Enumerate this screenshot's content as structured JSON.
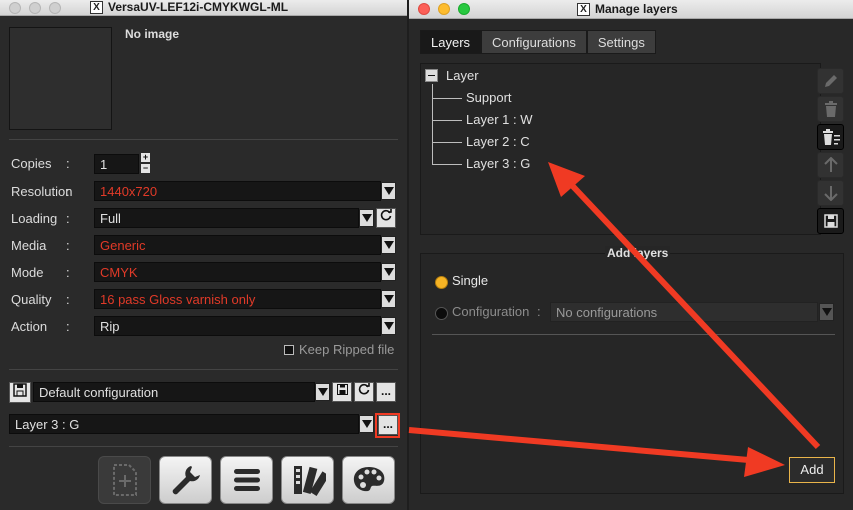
{
  "left_window": {
    "title": "VersaUV-LEF12i-CMYKWGL-ML",
    "no_image": "No image",
    "copies": {
      "label": "Copies",
      "colon": ":",
      "value": "1"
    },
    "resolution": {
      "label": "Resolution",
      "colon": ":",
      "value": "1440x720"
    },
    "loading": {
      "label": "Loading",
      "colon": ":",
      "value": "Full"
    },
    "media": {
      "label": "Media",
      "colon": ":",
      "value": "Generic"
    },
    "mode": {
      "label": "Mode",
      "colon": ":",
      "value": "CMYK"
    },
    "quality": {
      "label": "Quality",
      "colon": ":",
      "value": "16 pass Gloss varnish only"
    },
    "action": {
      "label": "Action",
      "colon": ":",
      "value": "Rip"
    },
    "keep_ripped": "Keep Ripped file",
    "configuration": "Default configuration",
    "layer_select": "Layer 3 : G",
    "more_label": "...",
    "icons": [
      "add-file-icon",
      "wrench-icon",
      "menu-icon",
      "swatch-icon",
      "palette-icon"
    ]
  },
  "right_window": {
    "title": "Manage layers",
    "tabs": [
      "Layers",
      "Configurations",
      "Settings"
    ],
    "active_tab": "Layers",
    "tree": {
      "root": "Layer",
      "children": [
        "Support",
        "Layer 1 : W",
        "Layer 2 : C",
        "Layer 3 : G"
      ]
    },
    "add_layers": {
      "title": "Add layers",
      "single": "Single",
      "configuration": "Configuration",
      "colon": ":",
      "config_placeholder": "No configurations"
    },
    "add_button": "Add"
  },
  "colors": {
    "accent_red": "#f03a23",
    "red_value": "#e13a28",
    "add_border": "#e9b44a",
    "radio_selected": "#f5b324"
  }
}
